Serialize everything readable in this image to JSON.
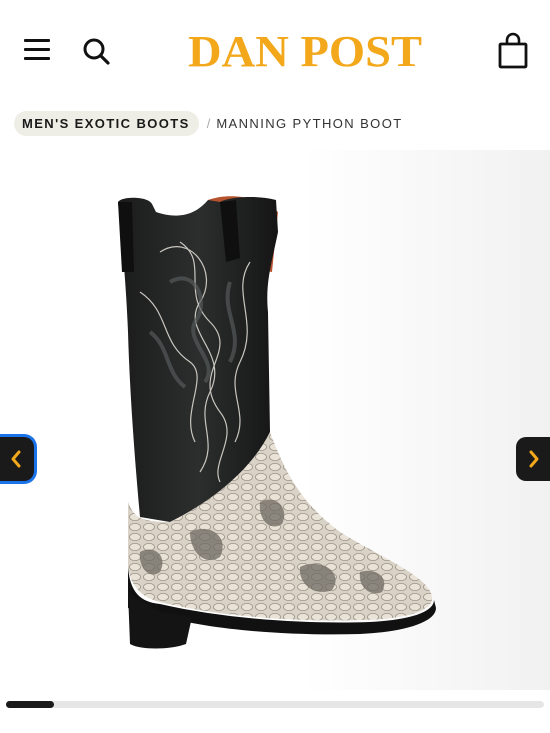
{
  "header": {
    "brand": "DAN POST",
    "brand_color": "#F3A81B",
    "menu_icon": "hamburger-menu-icon",
    "search_icon": "search-icon",
    "cart_icon": "shopping-bag-icon"
  },
  "breadcrumb": {
    "category": "MEN'S EXOTIC BOOTS",
    "separator": "/",
    "current": "MANNING PYTHON BOOT"
  },
  "gallery": {
    "image_alt": "Manning Python Boot",
    "prev_icon": "chevron-left-icon",
    "next_icon": "chevron-right-icon",
    "arrow_color": "#F3A81B",
    "progress_fraction": 0.09
  }
}
